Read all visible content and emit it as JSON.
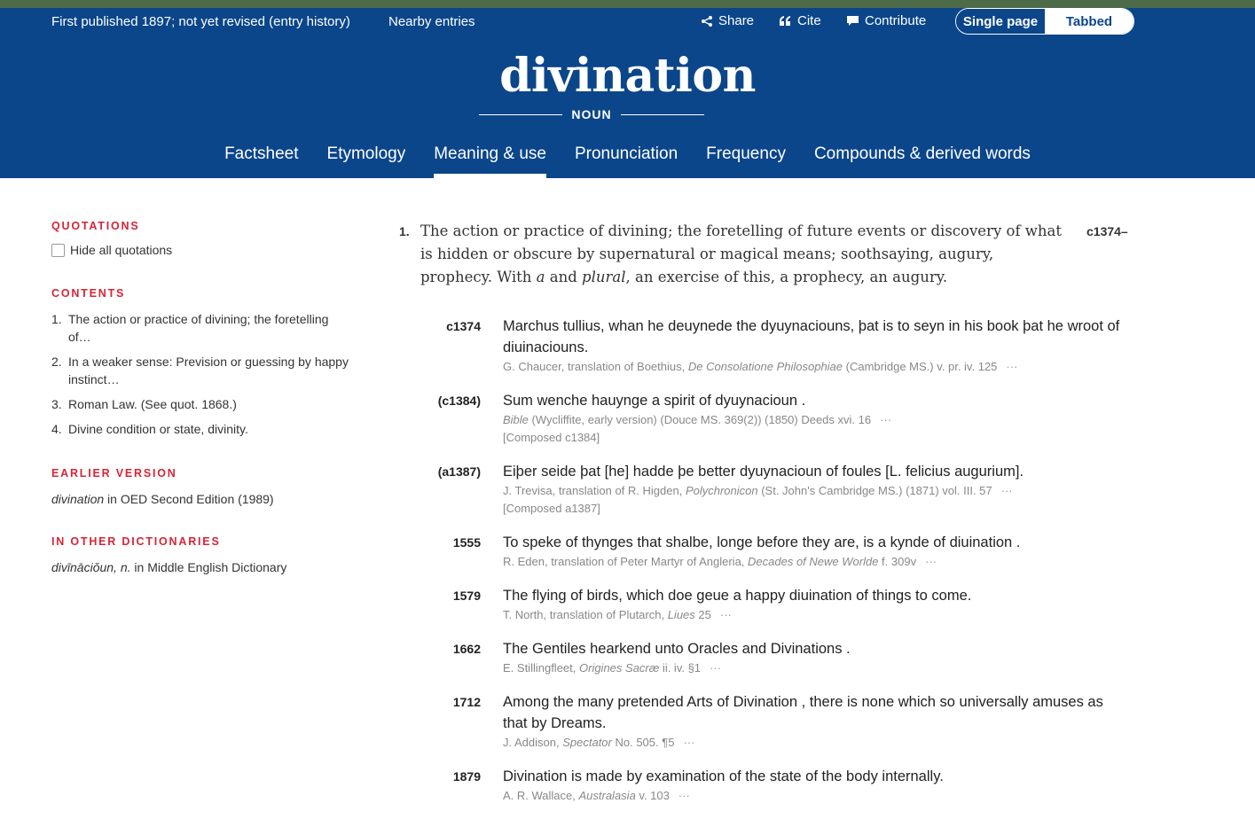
{
  "header": {
    "publication": "First published 1897; not yet revised (entry history)",
    "nearby": "Nearby entries",
    "share": "Share",
    "cite": "Cite",
    "contribute": "Contribute",
    "single_page": "Single page",
    "tabbed": "Tabbed",
    "headword": "divination",
    "pos": "NOUN"
  },
  "tabs": [
    "Factsheet",
    "Etymology",
    "Meaning & use",
    "Pronunciation",
    "Frequency",
    "Compounds & derived words"
  ],
  "active_tab": "Meaning & use",
  "sidebar": {
    "quotations_heading": "QUOTATIONS",
    "hide_quotations": "Hide all quotations",
    "contents_heading": "CONTENTS",
    "contents": [
      {
        "num": "1.",
        "text": "The action or practice of divining; the foretelling of…"
      },
      {
        "num": "2.",
        "text": "In a weaker sense: Prevision or guessing by happy instinct…"
      },
      {
        "num": "3.",
        "text": "Roman Law. (See quot. 1868.)"
      },
      {
        "num": "4.",
        "text": "Divine condition or state, divinity."
      }
    ],
    "earlier_heading": "EARLIER VERSION",
    "earlier_word": "divination",
    "earlier_text": " in OED Second Edition (1989)",
    "other_heading": "IN OTHER DICTIONARIES",
    "other_word": "divīnāciŏun, n.",
    "other_text": " in Middle English Dictionary"
  },
  "sense": {
    "number": "1.",
    "date": "c1374–",
    "def_a": "The action or practice of divining; the foretelling of future events or discovery of what is hidden or obscure by supernatural or magical means; soothsaying, augury, prophecy. With ",
    "def_a_italic": "a",
    "def_b": " and ",
    "def_b_italic": "plural",
    "def_c": ", an exercise of this, a prophecy, an augury."
  },
  "quotations": [
    {
      "date": "c1374",
      "text": "Marchus tullius, whan he deuynede the dyuynaciouns, þat is to seyn in his book þat he wroot of diuinaciouns.",
      "src_a": "G. Chaucer, translation of Boethius, ",
      "src_i": "De Consolatione Philosophiae",
      "src_b": " (Cambridge MS.) v. pr. iv. 125",
      "composed": ""
    },
    {
      "date": "(c1384)",
      "text": "Sum wenche hauynge a spirit of  dyuynacioun .",
      "src_a": "",
      "src_i": "Bible",
      "src_b": " (Wycliffite, early version) (Douce MS. 369(2)) (1850) Deeds xvi. 16",
      "composed": "[Composed c1384]"
    },
    {
      "date": "(a1387)",
      "text": "Eiþer seide þat [he] hadde þe better dyuynacioun of foules [L. felicius augurium].",
      "src_a": "J. Trevisa, translation of R. Higden, ",
      "src_i": "Polychronicon",
      "src_b": " (St. John's Cambridge MS.) (1871) vol. III. 57",
      "composed": "[Composed a1387]"
    },
    {
      "date": "1555",
      "text": "To speke of thynges that shalbe, longe before they are, is a kynde of  diuination .",
      "src_a": "R. Eden, translation of Peter Martyr of Angleria, ",
      "src_i": "Decades of Newe Worlde",
      "src_b": " f. 309v",
      "composed": ""
    },
    {
      "date": "1579",
      "text": "The flying of birds, which doe geue a happy  diuination  of things to come.",
      "src_a": "T. North, translation of Plutarch, ",
      "src_i": "Liues",
      "src_b": " 25",
      "composed": ""
    },
    {
      "date": "1662",
      "text": "The Gentiles hearkend unto Oracles and  Divinations .",
      "src_a": "E. Stillingfleet, ",
      "src_i": "Origines Sacræ",
      "src_b": " ii. iv. §1",
      "composed": ""
    },
    {
      "date": "1712",
      "text": "Among the many pretended Arts of  Divination , there is none which so universally amuses as that by Dreams.",
      "src_a": "J. Addison, ",
      "src_i": "Spectator",
      "src_b": " No. 505. ¶5",
      "composed": ""
    },
    {
      "date": "1879",
      "text": " Divination  is made by examination of the state of the body internally.",
      "src_a": "A. R. Wallace, ",
      "src_i": "Australasia",
      "src_b": " v. 103",
      "composed": ""
    }
  ],
  "more": "···"
}
